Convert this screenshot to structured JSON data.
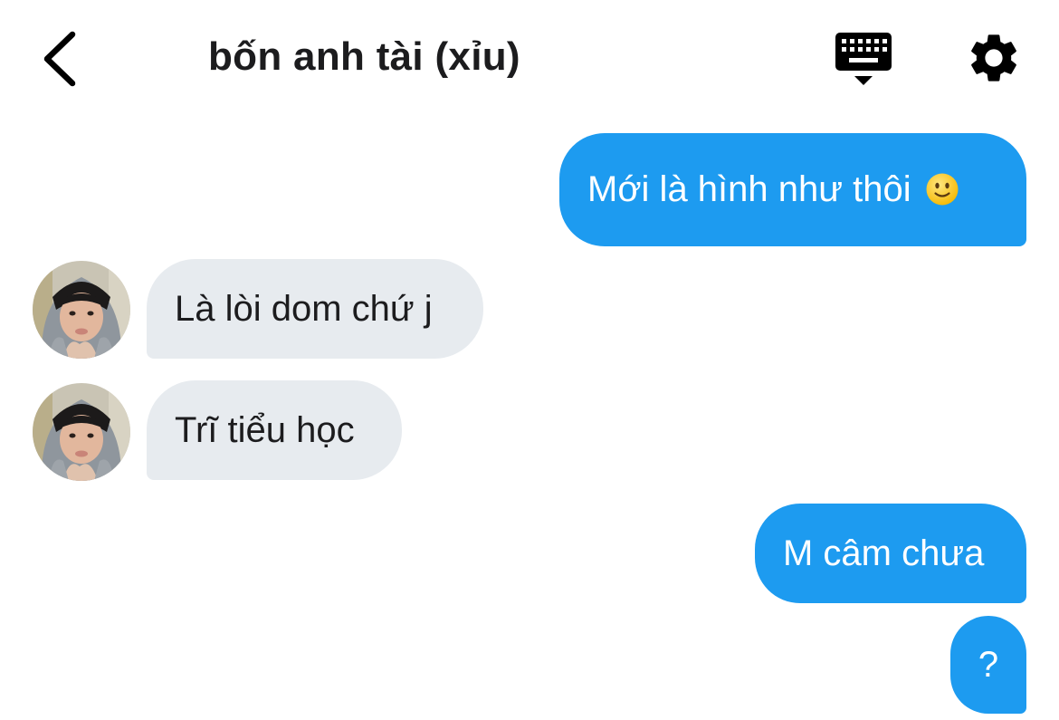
{
  "header": {
    "title": "bốn anh tài (xỉu)",
    "back_icon": "chevron-left-icon",
    "keyboard_icon": "keyboard-icon",
    "settings_icon": "gear-icon"
  },
  "messages": [
    {
      "direction": "outgoing",
      "text": "Mới là hình như thôi",
      "emoji": "slightly-smiling-face"
    },
    {
      "direction": "incoming",
      "text": "Là lòi dom chứ j"
    },
    {
      "direction": "incoming",
      "text": "Trĩ tiểu học"
    },
    {
      "direction": "outgoing",
      "text": "M câm chưa"
    },
    {
      "direction": "outgoing",
      "text": "?"
    }
  ],
  "colors": {
    "outgoing_bubble": "#1d9bf0",
    "incoming_bubble": "#e7ebef",
    "title_text": "#1c1c1e",
    "icon": "#000000"
  }
}
